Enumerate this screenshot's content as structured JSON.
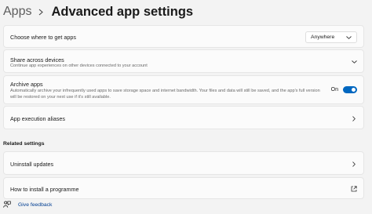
{
  "breadcrumb": {
    "parent": "Apps",
    "separator_icon": "chevron-right-icon",
    "title": "Advanced app settings"
  },
  "settings": {
    "get_apps": {
      "title": "Choose where to get apps",
      "dropdown_value": "Anywhere"
    },
    "share_across_devices": {
      "title": "Share across devices",
      "description": "Continue app experiences on other devices connected to your account",
      "expanded": false
    },
    "archive_apps": {
      "title": "Archive apps",
      "description": "Automatically archive your infrequently used apps to save storage space and internet bandwidth. Your files and data will still be saved, and the app's full version will be restored on your next use if it's still available.",
      "toggle_label": "On",
      "toggle_on": true
    },
    "app_execution_aliases": {
      "title": "App execution aliases"
    }
  },
  "related": {
    "heading": "Related settings",
    "uninstall_updates": "Uninstall updates",
    "how_to_install": "How to install a programme"
  },
  "feedback": {
    "label": "Give feedback",
    "icon": "feedback-icon"
  },
  "colors": {
    "accent": "#0067c0",
    "link": "#003e92",
    "background": "#f3f3f3",
    "card": "#fbfbfb"
  }
}
